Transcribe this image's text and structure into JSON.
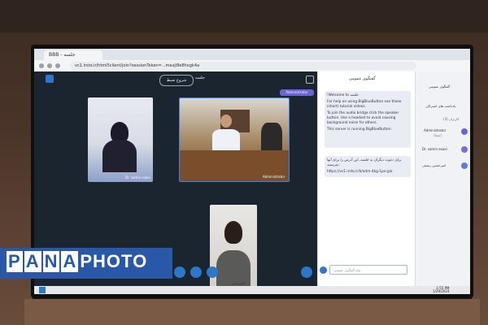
{
  "browser": {
    "tab_title": "BBB - جلسه",
    "url": "vc1.irsto.ir/html5client/join?sessionToken=...maxjl8e8hxgk4a"
  },
  "meeting": {
    "record_label": "شروع ضبط",
    "name": "جلسه",
    "presenter_badge": "Administrator",
    "participants": [
      {
        "label": "Dr. samin esaei"
      },
      {
        "label": "Administrator"
      },
      {
        "label": "امیرحسین"
      }
    ]
  },
  "chat": {
    "title": "گفتگوی عمومی",
    "message1_title": "!Welcome to جلسه",
    "message1_line2": "For help on using BigBlueButton see these (short) tutorial videos.",
    "message1_line3": "To join the audio bridge click the speaker button. Use a headset to avoid causing background noise for others.",
    "message1_line4": "This server is running BigBlueButton.",
    "message2_line1": "برای دعوت دیگران به جلسه، این آدرس را برای آنها بفرستید:",
    "message2_line2": "https://vc1.irsto.ir/b/adm-4kg-1pe-jpk",
    "input_placeholder": "پیام گفتگوی عمومی"
  },
  "users": {
    "public_chat": "گفتگوی عمومی",
    "shared_notes": "یادداشت های اشتراکی",
    "section_title": "کاربران (3)",
    "user1": "Administrator",
    "user1_role": "(شما)",
    "user2": "Dr. samin esaei",
    "user3": "امیرحسین رضیئی"
  },
  "taskbar": {
    "time": "1:55 PM",
    "date": "1/29/2024"
  },
  "watermark": {
    "p": "P",
    "a": "A",
    "n": "N",
    "a2": "A",
    "photo": "PHOTO"
  }
}
